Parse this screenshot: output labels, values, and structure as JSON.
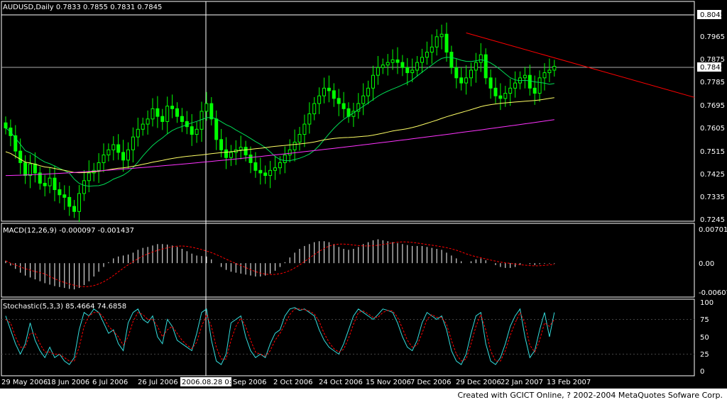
{
  "colors": {
    "background": "#000000",
    "frame": "#ffffff",
    "bull_candle": "#00ff00",
    "bear_candle": "#00ff00",
    "ma_fast": "#00dd55",
    "ma_medium": "#ffff66",
    "ma_slow": "#ff33ff",
    "trendline": "#ff0000",
    "macd_hist": "#ffffff",
    "macd_signal": "#ff0000",
    "stoch_main": "#33dddd",
    "stoch_signal": "#ff0000",
    "crosshair": "#ffffff",
    "text": "#ffffff"
  },
  "price_panel": {
    "title": "AUDUSD,Daily  0.7833 0.7855 0.7831 0.7845",
    "ticks": [
      "0.8045",
      "0.7965",
      "0.7875",
      "0.7785",
      "0.7695",
      "0.7605",
      "0.7515",
      "0.7425",
      "0.7335",
      "0.7245"
    ],
    "current_price_label": "0.7845"
  },
  "macd_panel": {
    "title": "MACD(12,26,9)  -0.000097  -0.001437",
    "ticks": [
      "0.00701",
      "0.00",
      "-0.00607"
    ]
  },
  "stoch_panel": {
    "title": "Stochastic(5,3,3)  85.4664  74.6858",
    "ticks": [
      "100",
      "75",
      "50",
      "25",
      "0"
    ]
  },
  "time_axis": {
    "labels": [
      "29 May 2006",
      "18 Jun 2006",
      "6 Jul 2006",
      "26 Jul 2006",
      "Sep 2006",
      "2 Oct 2006",
      "24 Oct 2006",
      "15 Nov 2006",
      "7 Dec 2006",
      "29 Dec 2006",
      "22 Jan 2007",
      "13 Feb 2007"
    ],
    "crosshair_date_label": "2006.08.28 0:00"
  },
  "footer_text": "Created with GCICT Online, ? 2002-2004 MetaQuotes Sofware Corp.",
  "chart_data": {
    "type": "candlestick",
    "symbol": "AUDUSD",
    "timeframe": "Daily",
    "last_bar": {
      "open": 0.7833,
      "high": 0.7855,
      "low": 0.7831,
      "close": 0.7845
    },
    "price_range": [
      0.7245,
      0.8045
    ],
    "closes": [
      0.7605,
      0.7575,
      0.7515,
      0.747,
      0.742,
      0.7465,
      0.743,
      0.739,
      0.738,
      0.741,
      0.7365,
      0.7345,
      0.7335,
      0.73,
      0.728,
      0.735,
      0.74,
      0.743,
      0.744,
      0.747,
      0.75,
      0.752,
      0.754,
      0.751,
      0.748,
      0.752,
      0.757,
      0.76,
      0.762,
      0.764,
      0.768,
      0.765,
      0.763,
      0.769,
      0.768,
      0.765,
      0.763,
      0.761,
      0.758,
      0.76,
      0.767,
      0.77,
      0.764,
      0.756,
      0.752,
      0.749,
      0.751,
      0.752,
      0.753,
      0.75,
      0.747,
      0.744,
      0.743,
      0.742,
      0.744,
      0.745,
      0.747,
      0.75,
      0.752,
      0.755,
      0.758,
      0.762,
      0.766,
      0.77,
      0.773,
      0.776,
      0.775,
      0.772,
      0.77,
      0.768,
      0.765,
      0.767,
      0.77,
      0.773,
      0.776,
      0.781,
      0.784,
      0.785,
      0.786,
      0.787,
      0.786,
      0.784,
      0.782,
      0.783,
      0.786,
      0.788,
      0.79,
      0.792,
      0.796,
      0.797,
      0.79,
      0.784,
      0.78,
      0.778,
      0.78,
      0.783,
      0.786,
      0.789,
      0.78,
      0.776,
      0.773,
      0.772,
      0.774,
      0.776,
      0.778,
      0.78,
      0.781,
      0.776,
      0.774,
      0.78,
      0.782,
      0.783,
      0.7845
    ],
    "trendline": [
      {
        "bar": 94,
        "price": 0.7975
      },
      {
        "bar": 146,
        "price": 0.7695
      }
    ],
    "macd_range": [
      -0.00607,
      0.00701
    ],
    "macd_hist": [
      0.0005,
      -0.0005,
      -0.0012,
      -0.002,
      -0.0026,
      -0.003,
      -0.0034,
      -0.0038,
      -0.0042,
      -0.0045,
      -0.0048,
      -0.005,
      -0.0052,
      -0.0054,
      -0.0055,
      -0.0052,
      -0.0046,
      -0.0038,
      -0.0028,
      -0.0018,
      -0.0008,
      0.0002,
      0.001,
      0.0014,
      0.0016,
      0.0018,
      0.0022,
      0.0028,
      0.0032,
      0.0034,
      0.0037,
      0.004,
      0.004,
      0.0039,
      0.0037,
      0.0034,
      0.003,
      0.0025,
      0.002,
      0.0016,
      0.0015,
      0.0014,
      0.0008,
      0.0,
      -0.0008,
      -0.0014,
      -0.0018,
      -0.002,
      -0.0022,
      -0.0024,
      -0.0026,
      -0.0028,
      -0.0028,
      -0.0026,
      -0.0022,
      -0.0016,
      -0.0008,
      0.0002,
      0.0012,
      0.0022,
      0.003,
      0.0036,
      0.004,
      0.0044,
      0.0046,
      0.0046,
      0.0044,
      0.004,
      0.0034,
      0.003,
      0.0028,
      0.003,
      0.0034,
      0.004,
      0.0044,
      0.0048,
      0.005,
      0.0048,
      0.0046,
      0.0044,
      0.0042,
      0.004,
      0.0038,
      0.0036,
      0.0036,
      0.0036,
      0.0034,
      0.0032,
      0.003,
      0.0028,
      0.0022,
      0.0016,
      0.001,
      0.0004,
      0.0,
      0.0004,
      0.0008,
      0.001,
      0.0006,
      0.0,
      -0.0004,
      -0.0008,
      -0.001,
      -0.001,
      -0.0008,
      -0.0004,
      0.0,
      -0.0002,
      -0.0004,
      -0.0002,
      -0.0001,
      -0.0001,
      -0.0001
    ],
    "stoch_main": [
      80,
      60,
      40,
      25,
      40,
      70,
      45,
      30,
      20,
      35,
      20,
      25,
      15,
      10,
      20,
      60,
      85,
      80,
      90,
      85,
      70,
      55,
      60,
      40,
      30,
      70,
      85,
      90,
      75,
      70,
      80,
      50,
      40,
      75,
      65,
      45,
      40,
      35,
      30,
      55,
      85,
      90,
      45,
      15,
      10,
      25,
      70,
      75,
      80,
      50,
      30,
      20,
      25,
      20,
      40,
      55,
      60,
      80,
      90,
      92,
      88,
      90,
      85,
      80,
      60,
      45,
      35,
      30,
      25,
      40,
      60,
      80,
      90,
      85,
      80,
      75,
      82,
      90,
      88,
      85,
      70,
      50,
      35,
      30,
      45,
      70,
      85,
      80,
      75,
      80,
      60,
      30,
      15,
      10,
      25,
      55,
      80,
      85,
      40,
      15,
      10,
      20,
      40,
      65,
      80,
      90,
      50,
      20,
      30,
      60,
      85,
      50,
      85
    ],
    "stoch_signal": [
      75,
      70,
      50,
      35,
      35,
      55,
      55,
      40,
      28,
      28,
      25,
      25,
      20,
      15,
      15,
      35,
      65,
      80,
      85,
      85,
      78,
      65,
      58,
      50,
      38,
      50,
      72,
      85,
      82,
      75,
      75,
      65,
      50,
      60,
      65,
      55,
      45,
      38,
      33,
      42,
      65,
      82,
      65,
      35,
      18,
      18,
      45,
      65,
      77,
      65,
      45,
      28,
      25,
      22,
      30,
      45,
      55,
      68,
      82,
      90,
      90,
      89,
      87,
      83,
      72,
      55,
      42,
      33,
      28,
      32,
      48,
      68,
      85,
      87,
      83,
      78,
      78,
      85,
      88,
      87,
      78,
      62,
      45,
      35,
      38,
      55,
      75,
      82,
      78,
      78,
      68,
      45,
      25,
      15,
      18,
      40,
      65,
      82,
      60,
      30,
      15,
      15,
      30,
      52,
      70,
      85,
      70,
      38,
      28,
      45,
      70,
      65,
      75
    ],
    "stoch_range": [
      0,
      100
    ]
  }
}
